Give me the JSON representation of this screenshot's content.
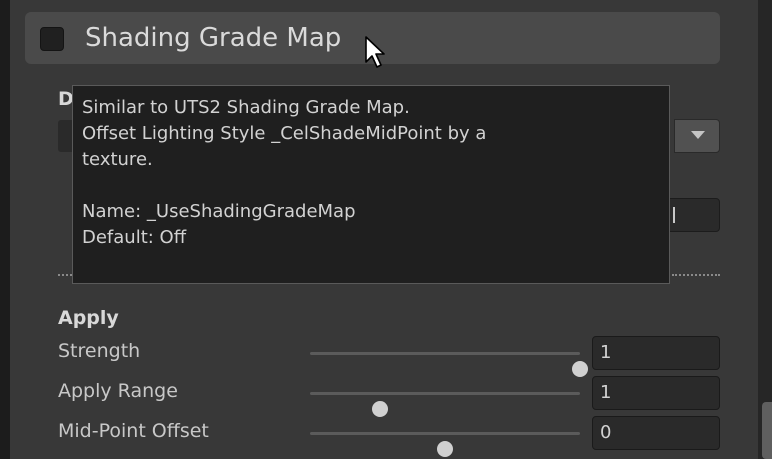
{
  "section": {
    "title": "Shading Grade Map",
    "checked": false
  },
  "obscured": {
    "label_initial": "D"
  },
  "tooltip": {
    "lines": [
      "Similar to UTS2 Shading Grade Map.",
      "Offset Lighting Style _CelShadeMidPoint by a",
      "texture.",
      "Name: _UseShadingGradeMap",
      "Default: Off"
    ]
  },
  "apply": {
    "header": "Apply",
    "rows": [
      {
        "label": "Strength",
        "value": "1",
        "slider_fraction": 1.0
      },
      {
        "label": "Apply Range",
        "value": "1",
        "slider_fraction": 0.26
      },
      {
        "label": "Mid-Point Offset",
        "value": "0",
        "slider_fraction": 0.5
      }
    ]
  },
  "icons": {
    "cursor": "mouse-pointer-icon",
    "dropdown": "dropdown-arrow-icon"
  },
  "colors": {
    "panel": "#383838",
    "header": "#4a4a4a",
    "tooltip_bg": "#1f1f1f",
    "field": "#2a2a2a"
  }
}
